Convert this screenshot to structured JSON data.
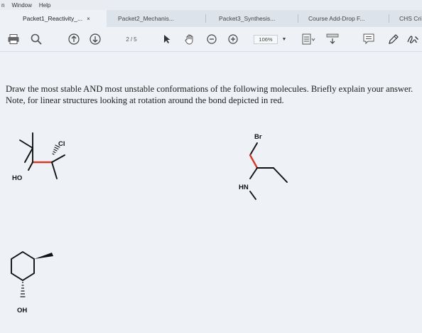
{
  "menu": {
    "items": [
      "n",
      "Window",
      "Help"
    ]
  },
  "tabs": [
    {
      "label": "Packet1_Reactivity_...",
      "close": "×",
      "active": true
    },
    {
      "label": "Packet2_Mechanis...",
      "close": "",
      "active": false
    },
    {
      "label": "Packet3_Synthesis...",
      "close": "",
      "active": false
    },
    {
      "label": "Course Add-Drop F...",
      "close": "",
      "active": false
    },
    {
      "label": "CHS Cri",
      "close": "",
      "active": false
    }
  ],
  "toolbar": {
    "page_current": "2",
    "page_sep": "/",
    "page_total": "5",
    "zoom": "106%",
    "icons": [
      "print-icon",
      "search-icon",
      "prev-page-icon",
      "next-page-icon",
      "select-cursor-icon",
      "hand-icon",
      "zoom-out-icon",
      "zoom-in-icon",
      "zoom-dropdown-icon",
      "fit-icon",
      "scroll-icon",
      "comment-icon",
      "pen-icon",
      "sign-icon"
    ]
  },
  "document": {
    "question": "Draw the most stable AND most unstable conformations of the following molecules. Briefly explain your answer. Note, for linear structures looking at rotation around the bond depicted in red."
  },
  "molecules": {
    "m1_labels": {
      "ho": "HO",
      "cl": "Cl"
    },
    "m2_labels": {
      "br": "Br",
      "hn": "HN"
    },
    "m3_labels": {
      "oh": "OH"
    }
  },
  "colors": {
    "red_bond": "#d23a2a",
    "bond": "#111111"
  }
}
